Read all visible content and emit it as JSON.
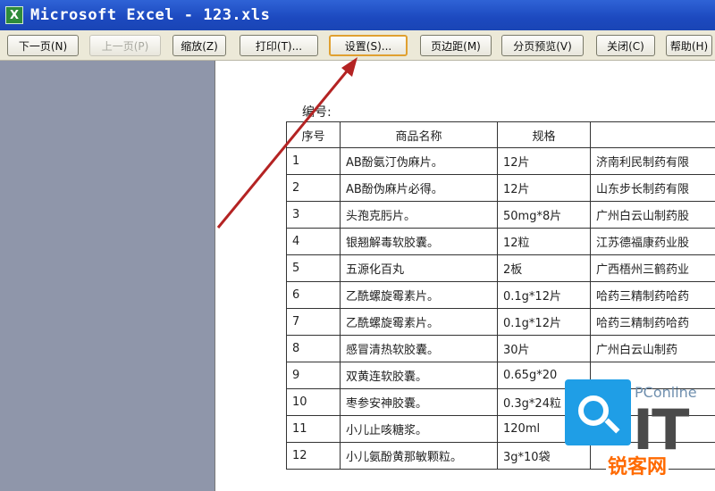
{
  "window": {
    "title": "Microsoft Excel - 123.xls",
    "app_icon_glyph": "X"
  },
  "toolbar": {
    "buttons": [
      {
        "label": "下一页(N)",
        "state": "enabled"
      },
      {
        "label": "上一页(P)",
        "state": "disabled"
      },
      {
        "label": "缩放(Z)",
        "state": "enabled"
      },
      {
        "label": "打印(T)...",
        "state": "enabled"
      },
      {
        "label": "设置(S)...",
        "state": "highlighted"
      },
      {
        "label": "页边距(M)",
        "state": "enabled"
      },
      {
        "label": "分页预览(V)",
        "state": "enabled"
      },
      {
        "label": "关闭(C)",
        "state": "enabled"
      },
      {
        "label": "帮助(H)",
        "state": "enabled"
      }
    ]
  },
  "sheet": {
    "serial_label": "编号:",
    "headers": [
      "序号",
      "商品名称",
      "规格",
      ""
    ],
    "rows": [
      [
        "1",
        "AB酚氨汀伪麻片。",
        "12片",
        "济南利民制药有限"
      ],
      [
        "2",
        "AB酚伪麻片必得。",
        "12片",
        "山东步长制药有限"
      ],
      [
        "3",
        "头孢克肟片。",
        "50mg*8片",
        "广州白云山制药股"
      ],
      [
        "4",
        "银翘解毒软胶囊。",
        "12粒",
        "江苏德福康药业股"
      ],
      [
        "5",
        "五源化百丸",
        "2板",
        "广西梧州三鹤药业"
      ],
      [
        "6",
        "乙酰螺旋霉素片。",
        "0.1g*12片",
        "哈药三精制药哈药"
      ],
      [
        "7",
        "乙酰螺旋霉素片。",
        "0.1g*12片",
        "哈药三精制药哈药"
      ],
      [
        "8",
        "感冒清热软胶囊。",
        "30片",
        "广州白云山制药"
      ],
      [
        "9",
        "双黄连软胶囊。",
        "0.65g*20",
        ""
      ],
      [
        "10",
        "枣参安神胶囊。",
        "0.3g*24粒",
        ""
      ],
      [
        "11",
        "小儿止咳糖浆。",
        "120ml",
        ""
      ],
      [
        "12",
        "小儿氨酚黄那敏颗粒。",
        "3g*10袋",
        ""
      ]
    ]
  },
  "watermark": {
    "site": "PConline",
    "big": "IT",
    "brand": "锐客网",
    "color": "#1f9ee6",
    "brand_color": "#ff6a00"
  },
  "annotation": {
    "color": "#b42323"
  }
}
